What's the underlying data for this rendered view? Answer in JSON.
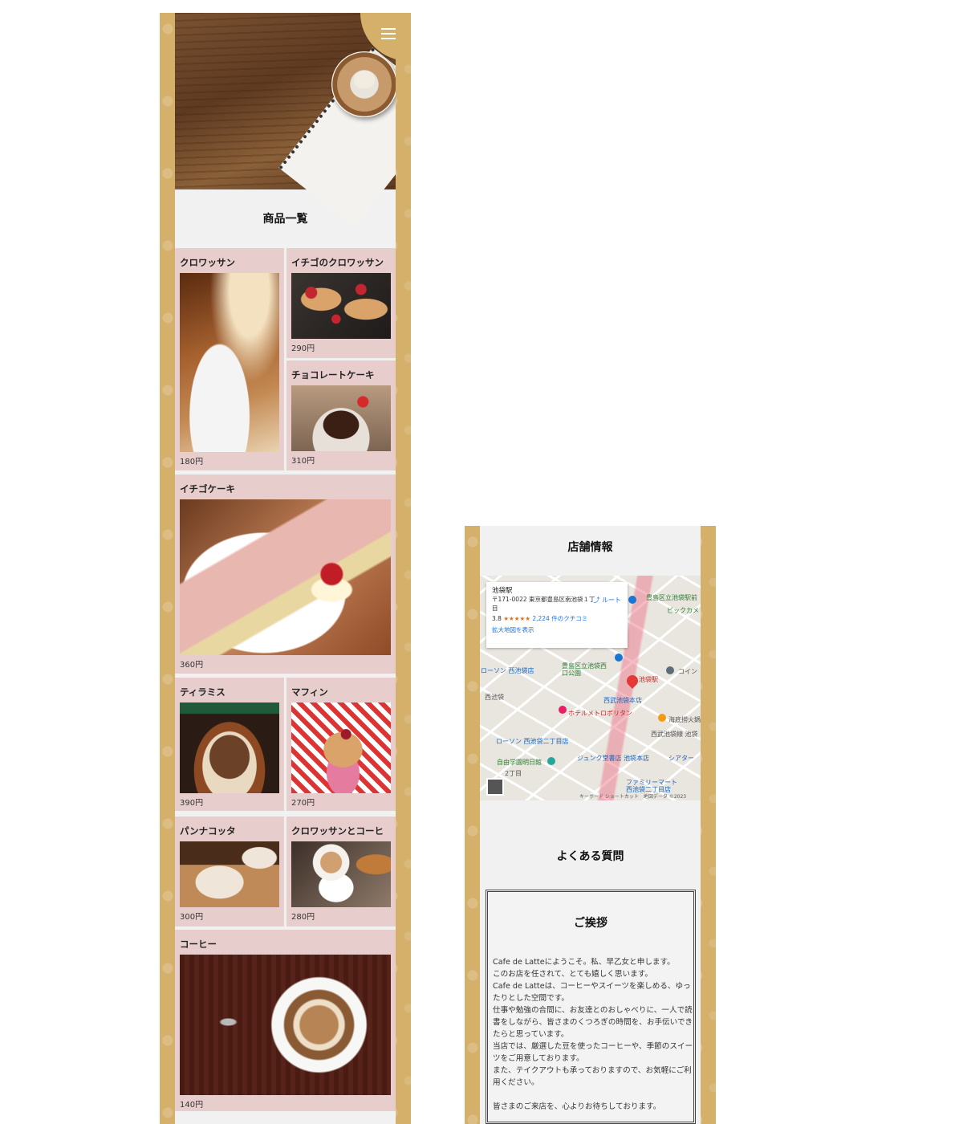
{
  "products_section": {
    "title": "商品一覧",
    "items": [
      {
        "name": "クロワッサン",
        "price": "180円",
        "image": "croissant-photo"
      },
      {
        "name": "イチゴのクロワッサン",
        "price": "290円",
        "image": "strawberry-croissant-photo"
      },
      {
        "name": "チョコレートケーキ",
        "price": "310円",
        "image": "chocolate-cake-photo"
      },
      {
        "name": "イチゴケーキ",
        "price": "360円",
        "image": "strawberry-cake-photo"
      },
      {
        "name": "ティラミス",
        "price": "390円",
        "image": "tiramisu-photo"
      },
      {
        "name": "マフィン",
        "price": "270円",
        "image": "muffin-photo"
      },
      {
        "name": "パンナコッタ",
        "price": "300円",
        "image": "pannacotta-photo"
      },
      {
        "name": "クロワッサンとコーヒ",
        "price": "280円",
        "image": "croissant-coffee-photo"
      },
      {
        "name": "コーヒー",
        "price": "140円",
        "image": "coffee-photo"
      }
    ]
  },
  "store_section": {
    "title": "店舗情報",
    "map": {
      "place_name": "池袋駅",
      "address": "〒171-0022 東京都豊島区南池袋１丁目",
      "route_label": "ルート",
      "rating": "3.8",
      "stars": "★★★★★",
      "reviews": "2,224 件のクチコミ",
      "enlarge_link": "拡大地図を表示",
      "labels": [
        "豊島区立池袋駅前",
        "ビックカメ",
        "ローソン 西池袋店",
        "豊島区立池袋西口公園",
        "コイン",
        "池袋駅",
        "西池袋",
        "西武池袋本店",
        "ホテルメトロポリタン",
        "海底撈火鍋",
        "西武池袋線 池袋",
        "ローソン 西池袋二丁目店",
        "自由学園明日館",
        "ジュンク堂書店 池袋本店",
        "シアター",
        "ファミリーマート 西池袋二丁目店",
        "2丁目"
      ],
      "footer": "キーボード ショートカット　地図データ ©2023"
    }
  },
  "faq_section": {
    "title": "よくある質問"
  },
  "greeting_section": {
    "title": "ご挨拶",
    "paragraphs": [
      "Cafe de Latteにようこそ。私、早乙女と申します。",
      "このお店を任されて、とても嬉しく思います。",
      "Cafe de Latteは、コーヒーやスイーツを楽しめる、ゆったりとした空間です。",
      "仕事や勉強の合間に、お友達とのおしゃべりに、一人で読書をしながら、皆さまのくつろぎの時間を、お手伝いできたらと思っています。",
      "当店では、厳選した豆を使ったコーヒーや、季節のスイーツをご用意しております。",
      "また、テイクアウトも承っておりますので、お気軽にご利用ください。"
    ],
    "closing": "皆さまのご来店を、心よりお待ちしております。"
  },
  "colors": {
    "frame": "#d4b06a",
    "card": "#e8cdcd",
    "panel": "#f1f1f1"
  }
}
